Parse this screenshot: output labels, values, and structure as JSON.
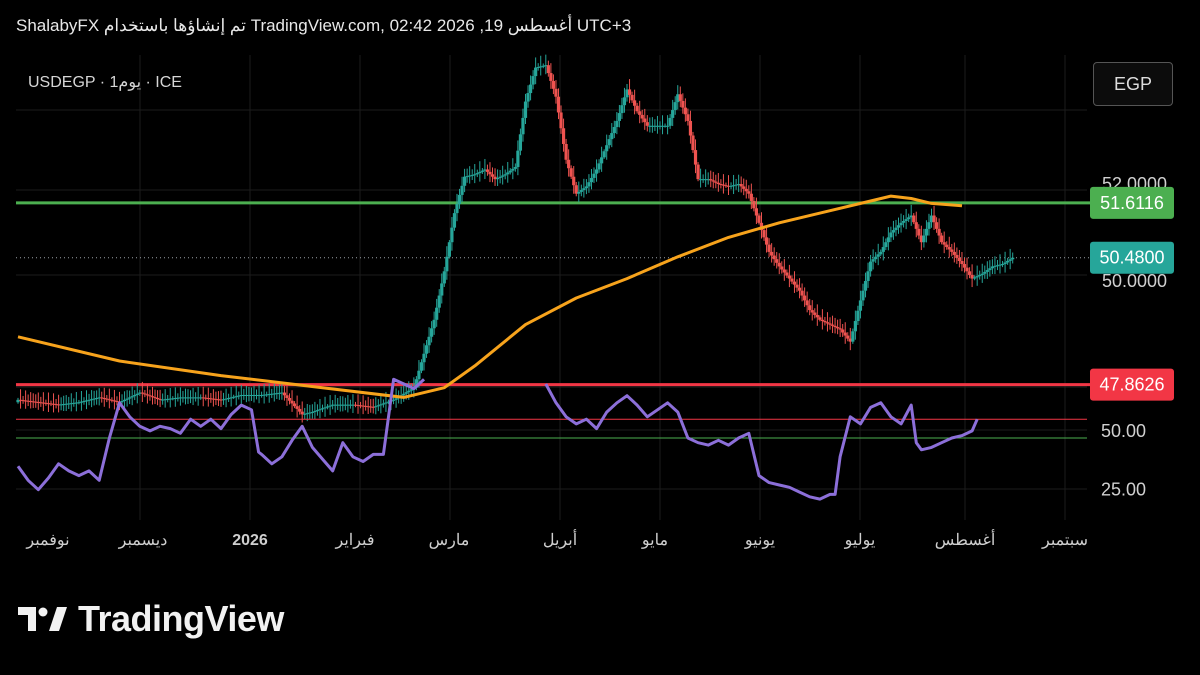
{
  "header": {
    "text": "ShalabyFX تم إنشاؤها باستخدام TradingView.com, 02:42 2026 ,19 أغسطس UTC+3"
  },
  "symbol": {
    "text": "USDEGP · 1يوم · ICE"
  },
  "currency_button": {
    "label": "EGP"
  },
  "footer": {
    "brand": "TradingView"
  },
  "colors": {
    "up": "#26a69a",
    "down": "#ef5350",
    "ma": "#f7a31c",
    "rsi": "#8c6fd9",
    "green_line": "#4caf50",
    "red_line": "#f23645",
    "green_tag": "#4caf50",
    "current_tag": "#26a69a",
    "red_tag": "#f23645",
    "grid": "#1c1c1c"
  },
  "chart_data": [
    {
      "type": "candlestick",
      "symbol": "USDEGP",
      "interval": "1يوم",
      "exchange": "ICE",
      "currency": "EGP",
      "x_labels": [
        "نوفمبر",
        "ديسمبر",
        "2026",
        "فبراير",
        "مارس",
        "أبريل",
        "مايو",
        "يونيو",
        "يوليو",
        "أغسطس",
        "سبتمبر"
      ],
      "y_ticks": [
        "52.0000",
        "50.0000"
      ],
      "price_tags": [
        {
          "value": "51.6116",
          "kind": "green-line"
        },
        {
          "value": "50.4800",
          "kind": "current"
        },
        {
          "value": "47.8626",
          "kind": "red-line"
        }
      ],
      "last_price": 50.48,
      "horizontal_lines": {
        "green": 51.6116,
        "red": 47.8626
      },
      "close_path": [
        [
          0,
          47.55
        ],
        [
          4,
          47.45
        ],
        [
          6,
          47.5
        ],
        [
          8,
          47.6
        ],
        [
          10,
          47.5
        ],
        [
          12,
          47.7
        ],
        [
          14,
          47.55
        ],
        [
          16,
          47.6
        ],
        [
          18,
          47.6
        ],
        [
          20,
          47.55
        ],
        [
          22,
          47.65
        ],
        [
          24,
          47.65
        ],
        [
          26,
          47.7
        ],
        [
          28,
          47.25
        ],
        [
          29,
          47.3
        ],
        [
          31,
          47.45
        ],
        [
          33,
          47.45
        ],
        [
          35,
          47.4
        ],
        [
          37,
          47.55
        ],
        [
          39,
          47.8
        ],
        [
          41,
          49.2
        ],
        [
          42,
          50.2
        ],
        [
          43,
          51.4
        ],
        [
          44,
          52.15
        ],
        [
          45,
          52.2
        ],
        [
          46,
          52.3
        ],
        [
          47,
          52.1
        ],
        [
          48,
          52.2
        ],
        [
          49,
          52.35
        ],
        [
          50,
          53.7
        ],
        [
          51,
          54.4
        ],
        [
          52,
          54.45
        ],
        [
          53,
          53.8
        ],
        [
          54,
          52.5
        ],
        [
          55,
          51.8
        ],
        [
          56,
          51.95
        ],
        [
          57,
          52.3
        ],
        [
          58,
          52.8
        ],
        [
          59,
          53.3
        ],
        [
          60,
          53.95
        ],
        [
          61,
          53.5
        ],
        [
          62,
          53.2
        ],
        [
          64,
          53.2
        ],
        [
          65,
          53.85
        ],
        [
          66,
          53.3
        ],
        [
          67,
          52.1
        ],
        [
          68,
          52.1
        ],
        [
          69,
          52.0
        ],
        [
          70,
          51.95
        ],
        [
          71,
          52.0
        ],
        [
          72,
          51.8
        ],
        [
          73,
          51.2
        ],
        [
          74,
          50.6
        ],
        [
          75,
          50.3
        ],
        [
          76,
          50.05
        ],
        [
          77,
          49.8
        ],
        [
          78,
          49.4
        ],
        [
          79,
          49.2
        ],
        [
          80,
          49.1
        ],
        [
          81,
          49.0
        ],
        [
          82,
          48.75
        ],
        [
          83,
          49.6
        ],
        [
          84,
          50.4
        ],
        [
          85,
          50.6
        ],
        [
          86,
          51.0
        ],
        [
          87,
          51.2
        ],
        [
          88,
          51.35
        ],
        [
          89,
          50.8
        ],
        [
          90,
          51.35
        ],
        [
          91,
          50.8
        ],
        [
          92,
          50.6
        ],
        [
          93,
          50.35
        ],
        [
          94,
          50.05
        ],
        [
          95,
          50.15
        ],
        [
          96,
          50.3
        ],
        [
          97,
          50.35
        ],
        [
          98,
          50.48
        ]
      ],
      "moving_average": [
        [
          0,
          48.85
        ],
        [
          10,
          48.35
        ],
        [
          20,
          48.05
        ],
        [
          30,
          47.8
        ],
        [
          38,
          47.6
        ],
        [
          42,
          47.8
        ],
        [
          45,
          48.25
        ],
        [
          50,
          49.1
        ],
        [
          55,
          49.65
        ],
        [
          60,
          50.05
        ],
        [
          65,
          50.5
        ],
        [
          70,
          50.9
        ],
        [
          75,
          51.2
        ],
        [
          80,
          51.45
        ],
        [
          84,
          51.65
        ],
        [
          86,
          51.75
        ],
        [
          88,
          51.7
        ],
        [
          90,
          51.6
        ],
        [
          93,
          51.55
        ]
      ]
    },
    {
      "type": "line",
      "name": "RSI",
      "y_ticks": [
        "50.00",
        "25.00"
      ],
      "levels": [
        {
          "value": 55,
          "color": "#f23645"
        },
        {
          "value": 47,
          "color": "#4caf50"
        }
      ],
      "values": [
        [
          0,
          35
        ],
        [
          1,
          29
        ],
        [
          2,
          25
        ],
        [
          3,
          30
        ],
        [
          4,
          36
        ],
        [
          5,
          33
        ],
        [
          6,
          31
        ],
        [
          7,
          33
        ],
        [
          8,
          29
        ],
        [
          9,
          47
        ],
        [
          10,
          62
        ],
        [
          11,
          56
        ],
        [
          12,
          52
        ],
        [
          13,
          50
        ],
        [
          14,
          52
        ],
        [
          15,
          51
        ],
        [
          16,
          49
        ],
        [
          17,
          55
        ],
        [
          18,
          52
        ],
        [
          19,
          55
        ],
        [
          20,
          51
        ],
        [
          21,
          57
        ],
        [
          22,
          61
        ],
        [
          23,
          59
        ],
        [
          23.7,
          41
        ],
        [
          24,
          40
        ],
        [
          25,
          36
        ],
        [
          26,
          39
        ],
        [
          27,
          46
        ],
        [
          28,
          52
        ],
        [
          29,
          43
        ],
        [
          30,
          38
        ],
        [
          31,
          33
        ],
        [
          32,
          45
        ],
        [
          33,
          39
        ],
        [
          34,
          37
        ],
        [
          35,
          40
        ],
        [
          36,
          40
        ],
        [
          37,
          72
        ],
        [
          38,
          70
        ],
        [
          39,
          68
        ],
        [
          40,
          72
        ],
        [
          52,
          70
        ],
        [
          53,
          62
        ],
        [
          54,
          56
        ],
        [
          55,
          53
        ],
        [
          56,
          55
        ],
        [
          57,
          51
        ],
        [
          58,
          58
        ],
        [
          59,
          62
        ],
        [
          60,
          65
        ],
        [
          61,
          61
        ],
        [
          62,
          56
        ],
        [
          63,
          59
        ],
        [
          64,
          62
        ],
        [
          65,
          58
        ],
        [
          66,
          47
        ],
        [
          67,
          45
        ],
        [
          68,
          44
        ],
        [
          69,
          46
        ],
        [
          70,
          44
        ],
        [
          71,
          47
        ],
        [
          72,
          49
        ],
        [
          73,
          31
        ],
        [
          74,
          28
        ],
        [
          75,
          27
        ],
        [
          76,
          26
        ],
        [
          77,
          24
        ],
        [
          78,
          22
        ],
        [
          79,
          21
        ],
        [
          80,
          23
        ],
        [
          80.5,
          23
        ],
        [
          81,
          39
        ],
        [
          82,
          56
        ],
        [
          83,
          53
        ],
        [
          84,
          60
        ],
        [
          85,
          62
        ],
        [
          86,
          56
        ],
        [
          87,
          53
        ],
        [
          88,
          61
        ],
        [
          88.5,
          45
        ],
        [
          89,
          42
        ],
        [
          90,
          43
        ],
        [
          91,
          45
        ],
        [
          92,
          47
        ],
        [
          93,
          48
        ],
        [
          94,
          50
        ],
        [
          94.5,
          55
        ]
      ]
    }
  ]
}
